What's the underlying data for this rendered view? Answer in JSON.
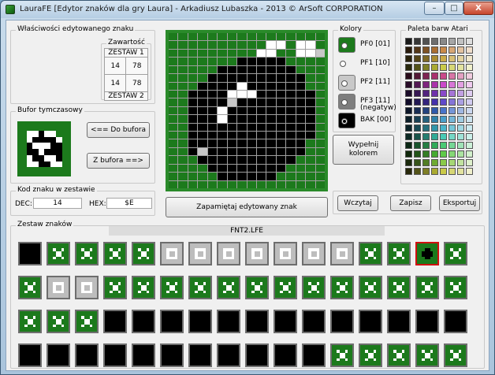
{
  "window": {
    "title": "LauraFE [Edytor znaków dla gry Laura] - Arkadiusz Lubaszka - 2013 © ArSoft CORPORATION",
    "min_label": "–",
    "max_label": "□",
    "close_label": "X"
  },
  "props": {
    "legend": "Właściwości edytowanego znaku",
    "content_legend": "Zawartość",
    "set1": "ZESTAW 1",
    "set2": "ZESTAW 2",
    "cells": [
      [
        "14",
        "78"
      ],
      [
        "14",
        "78"
      ]
    ]
  },
  "buffer": {
    "legend": "Bufor tymczasowy",
    "to_buffer": "<==   Do bufora",
    "from_buffer": "Z bufora   ==>"
  },
  "code": {
    "legend": "Kod znaku w zestawie",
    "dec_label": "DEC:",
    "dec_value": "14",
    "hex_label": "HEX:",
    "hex_value": "$E"
  },
  "editor": {
    "save_label": "Zapamiętaj edytowany znak",
    "grid": [
      "GGGGGGGGGGGGGGGG",
      "GGGGGGGGGGWWGWWG",
      "GGGGGGGGGWWGGWWS",
      "GGGGGGGBBBBBGGGG",
      "GGGGGBBBBBBBBGGG",
      "GGGGBBBBBBBBBBGG",
      "GGGBBBBWBBBBBBGG",
      "GGBBBBWWWBBBBBBG",
      "GGBBBBSBBBBBBBBG",
      "GGBBBWBBBBBBBBBG",
      "GGBBBWBBBBBBBBBG",
      "GGBBBBBBBBBBBBBG",
      "GGBBBBBBBBBBBBBG",
      "GGBBBBBBBBBBBBGG",
      "GGBSBBBBBBBBBBGG",
      "GGGBBBBBBBBBBGGG",
      "GGGGBBBBBBBBGGGG",
      "GGGGGBBBBBBGGGGG",
      "GGGGGGGGGGGGGGGG"
    ]
  },
  "colors": {
    "legend": "Kolory",
    "items": [
      {
        "label": "PF0 [01]",
        "color": "#1c7a1c"
      },
      {
        "label": "PF1 [10]",
        "color": "#ffffff"
      },
      {
        "label": "PF2 [11]",
        "color": "#c8c8c8"
      },
      {
        "label": "PF3 [11]",
        "sub": "(negatyw)",
        "color": "#7e7e7e"
      },
      {
        "label": "BAK [00]",
        "color": "#000000"
      }
    ],
    "fill_label": "Wypełnij kolorem"
  },
  "palette": {
    "legend": "Paleta barw Atari"
  },
  "file": {
    "load": "Wczytaj",
    "save": "Zapisz",
    "export": "Eksportuj"
  },
  "charset": {
    "legend": "Zestaw znaków",
    "filename": "FNT2.LFE"
  }
}
